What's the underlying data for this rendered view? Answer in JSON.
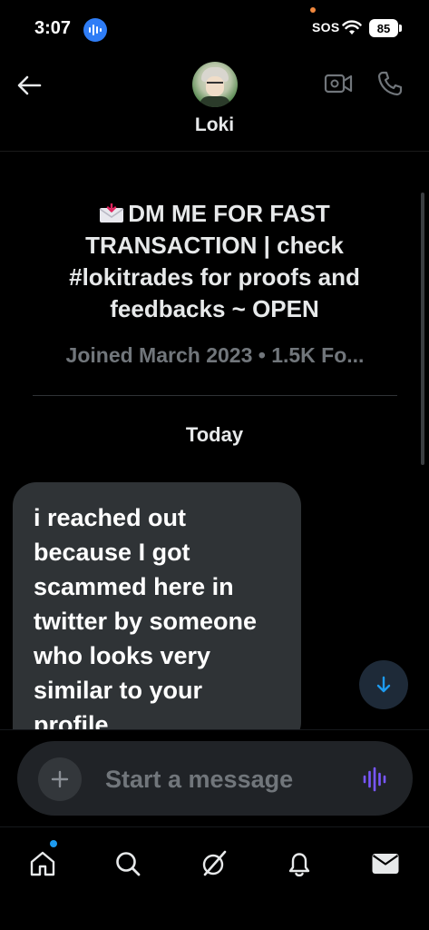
{
  "status_bar": {
    "time": "3:07",
    "sos": "SOS",
    "battery": "85"
  },
  "header": {
    "contact_name": "Loki",
    "icons": [
      "back-arrow-icon",
      "video-call-icon",
      "phone-icon"
    ]
  },
  "profile": {
    "bio": "DM ME FOR FAST TRANSACTION | check #lokitrades for proofs and feedbacks ~ OPEN",
    "bio_icon": "incoming-envelope-emoji",
    "joined": "Joined March 2023 • 1.5K Fo..."
  },
  "conversation": {
    "date_separator": "Today",
    "messages": [
      {
        "direction": "incoming",
        "text": "i  reached out because I got scammed here in twitter by someone who looks very similar to your profile"
      }
    ]
  },
  "composer": {
    "placeholder": "Start a message",
    "value": ""
  },
  "bottom_nav": {
    "items": [
      "home-icon",
      "search-icon",
      "grok-icon",
      "notifications-icon",
      "messages-icon"
    ],
    "home_has_notification_dot": true
  },
  "colors": {
    "background": "#000000",
    "bubble": "#2f3336",
    "accent": "#1d9bf0",
    "muted_text": "#71767b",
    "voice_icon": "#7856ff",
    "live_pill": "#2f7df6"
  }
}
